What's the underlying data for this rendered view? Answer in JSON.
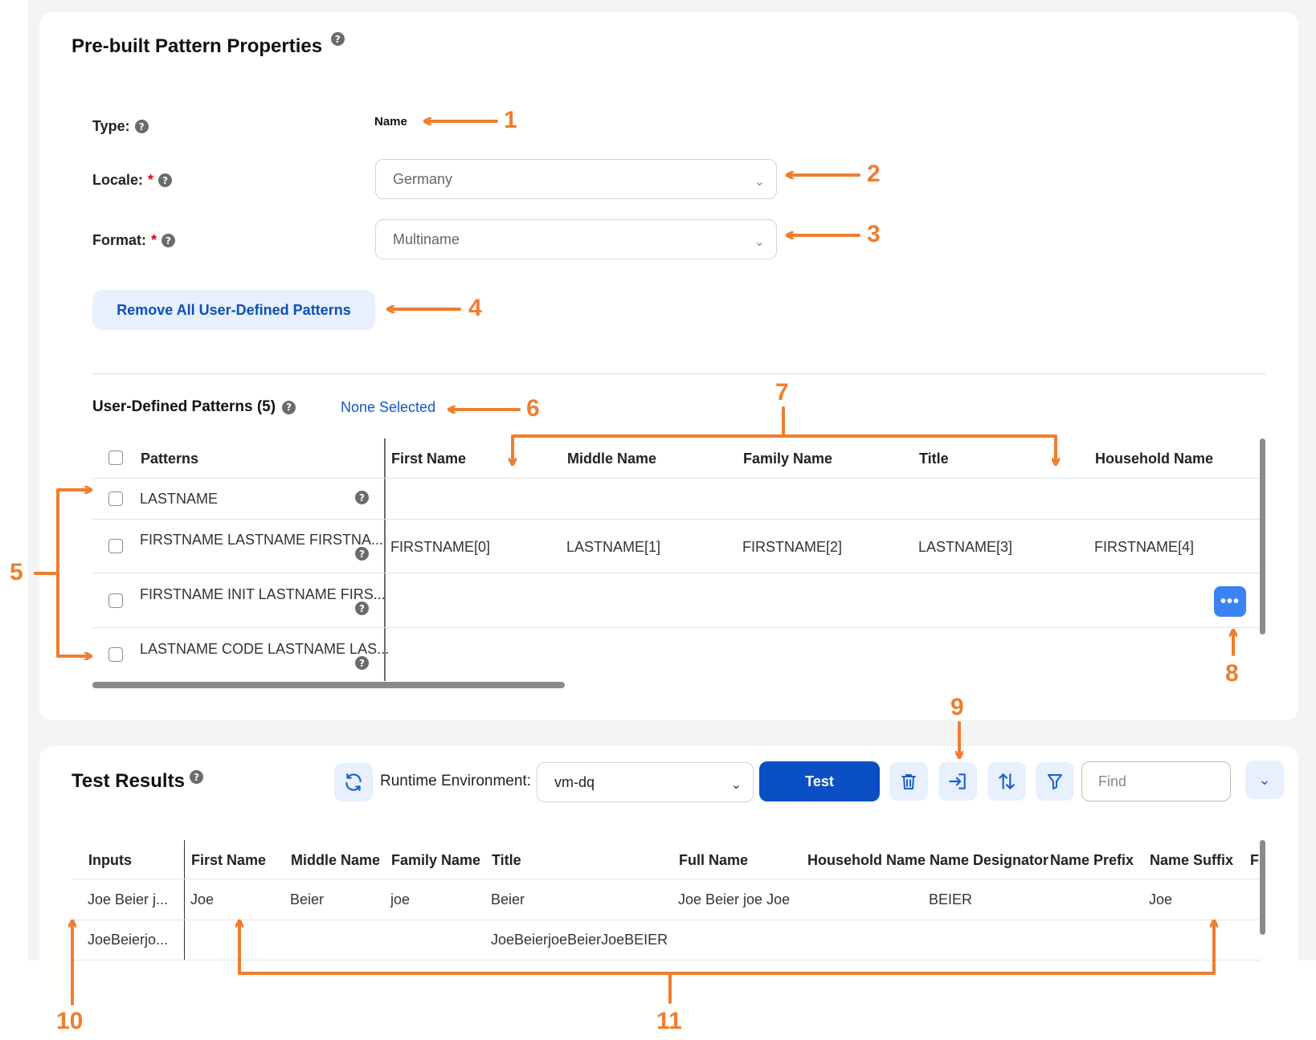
{
  "pattern_properties": {
    "title": "Pre-built Pattern Properties",
    "type_label": "Type:",
    "type_value": "Name",
    "locale_label": "Locale:",
    "locale_value": "Germany",
    "format_label": "Format:",
    "format_value": "Multiname",
    "required_mark": "*",
    "remove_button": "Remove All User-Defined Patterns"
  },
  "user_defined": {
    "title": "User-Defined Patterns (5)",
    "selection_status": "None Selected",
    "columns": [
      "Patterns",
      "First Name",
      "Middle Name",
      "Family Name",
      "Title",
      "Household Name"
    ],
    "rows": [
      {
        "pattern": "LASTNAME",
        "values": [
          "",
          "",
          "",
          "",
          ""
        ]
      },
      {
        "pattern": "FIRSTNAME LASTNAME FIRSTNA...",
        "values": [
          "FIRSTNAME[0]",
          "LASTNAME[1]",
          "FIRSTNAME[2]",
          "LASTNAME[3]",
          "FIRSTNAME[4]"
        ]
      },
      {
        "pattern": "FIRSTNAME INIT LASTNAME FIRS...",
        "values": [
          "",
          "",
          "",
          "",
          ""
        ]
      },
      {
        "pattern": "LASTNAME CODE LASTNAME LAS...",
        "values": [
          "",
          "",
          "",
          "",
          ""
        ]
      }
    ],
    "more_button": "•••"
  },
  "test_results": {
    "title": "Test Results",
    "runtime_label": "Runtime Environment:",
    "runtime_value": "vm-dq",
    "test_button": "Test",
    "find_placeholder": "Find",
    "columns": [
      "Inputs",
      "First Name",
      "Middle Name",
      "Family Name",
      "Title",
      "Full Name",
      "Household Name",
      "Name Designator",
      "Name Prefix",
      "Name Suffix",
      "Fi"
    ],
    "rows": [
      {
        "input": "Joe Beier j...",
        "first_name": "Joe",
        "middle_name": "Beier",
        "family_name": "joe",
        "title": "Beier",
        "full_name": "Joe Beier joe Joe",
        "household_name": "",
        "name_designator": "BEIER",
        "name_prefix": "",
        "name_suffix": "Joe"
      },
      {
        "input": "JoeBeierjo...",
        "first_name": "",
        "middle_name": "",
        "family_name": "",
        "title": "JoeBeierjoeBeierJoeBEIER",
        "full_name": "",
        "household_name": "",
        "name_designator": "",
        "name_prefix": "",
        "name_suffix": ""
      }
    ]
  },
  "annotations": [
    "1",
    "2",
    "3",
    "4",
    "5",
    "6",
    "7",
    "8",
    "9",
    "10",
    "11"
  ],
  "colors": {
    "accent": "#0b4fc4",
    "callout": "#ef7d2f",
    "link": "#1155cc"
  },
  "icons": [
    "help-icon",
    "chevron-down-icon",
    "refresh-icon",
    "trash-icon",
    "import-icon",
    "sort-icon",
    "filter-icon",
    "more-icon"
  ]
}
